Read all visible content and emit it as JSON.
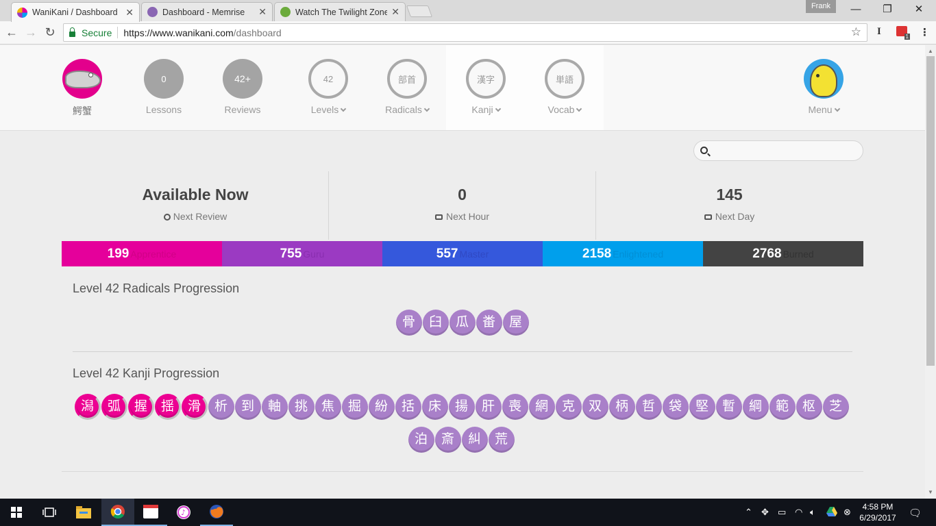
{
  "browser": {
    "tabs": [
      {
        "title": "WaniKani / Dashboard",
        "active": true
      },
      {
        "title": "Dashboard - Memrise",
        "active": false
      },
      {
        "title": "Watch The Twilight Zone",
        "active": false
      }
    ],
    "profile_name": "Frank",
    "secure_label": "Secure",
    "url_scheme_host": "https://www.wanikani.com",
    "url_path": "/dashboard",
    "extension_badge": "1"
  },
  "nav": {
    "username": "鰐蟹",
    "lessons": {
      "count": "0",
      "label": "Lessons"
    },
    "reviews": {
      "count": "42+",
      "label": "Reviews"
    },
    "levels": {
      "value": "42",
      "label": "Levels"
    },
    "radicals": {
      "glyph": "部首",
      "label": "Radicals"
    },
    "kanji": {
      "glyph": "漢字",
      "label": "Kanji"
    },
    "vocab": {
      "glyph": "単語",
      "label": "Vocab"
    },
    "menu": {
      "label": "Menu"
    }
  },
  "search": {
    "placeholder": ""
  },
  "forecast": {
    "next_review": {
      "value": "Available Now",
      "label": "Next Review"
    },
    "next_hour": {
      "value": "0",
      "label": "Next Hour"
    },
    "next_day": {
      "value": "145",
      "label": "Next Day"
    }
  },
  "srs": [
    {
      "count": "199",
      "label": "Apprentice",
      "color": "#e5009b"
    },
    {
      "count": "755",
      "label": "Guru",
      "color": "#9b3ac2"
    },
    {
      "count": "557",
      "label": "Master",
      "color": "#3558dc"
    },
    {
      "count": "2158",
      "label": "Enlightened",
      "color": "#009fec"
    },
    {
      "count": "2768",
      "label": "Burned",
      "color": "#434343"
    }
  ],
  "radicals_progress": {
    "title": "Level 42 Radicals Progression",
    "items": [
      "骨",
      "臼",
      "瓜",
      "畨",
      "屋"
    ]
  },
  "kanji_progress": {
    "title": "Level 42 Kanji Progression",
    "row1": [
      "潟",
      "弧",
      "握",
      "揺",
      "滑",
      "析",
      "到",
      "軸",
      "挑",
      "焦",
      "掘",
      "紛",
      "括",
      "床",
      "揚",
      "肝",
      "喪",
      "網",
      "克",
      "双",
      "柄",
      "哲",
      "袋",
      "堅",
      "暫",
      "綱",
      "範",
      "枢",
      "芝"
    ],
    "row2": [
      "泊",
      "斎",
      "糾",
      "荒"
    ],
    "started_count": 5
  },
  "taskbar": {
    "time": "4:58 PM",
    "date": "6/29/2017"
  }
}
